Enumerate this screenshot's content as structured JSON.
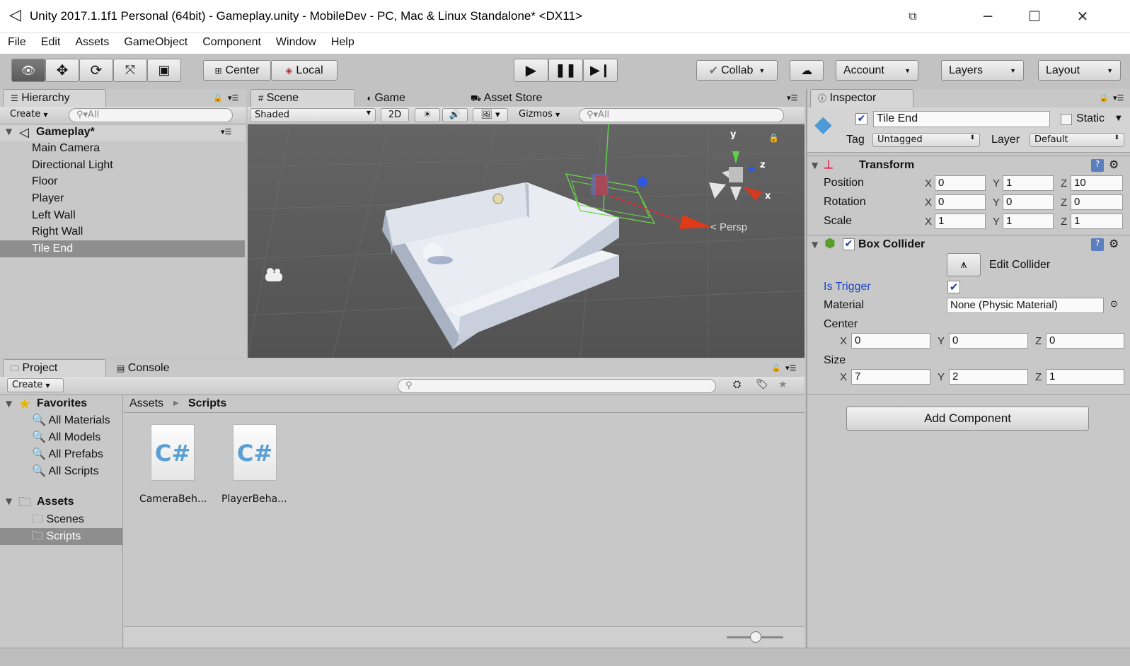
{
  "window": {
    "title": "Unity 2017.1.1f1 Personal (64bit) - Gameplay.unity - MobileDev - PC, Mac & Linux Standalone* <DX11>"
  },
  "menu": [
    "File",
    "Edit",
    "Assets",
    "GameObject",
    "Component",
    "Window",
    "Help"
  ],
  "toolbar": {
    "pivot": "Center",
    "space": "Local",
    "collab": "Collab",
    "account": "Account",
    "layers": "Layers",
    "layout": "Layout"
  },
  "hierarchy": {
    "tab": "Hierarchy",
    "create": "Create",
    "search_placeholder": "All",
    "scene": "Gameplay*",
    "items": [
      "Main Camera",
      "Directional Light",
      "Floor",
      "Player",
      "Left Wall",
      "Right Wall",
      "Tile End"
    ],
    "selected": "Tile End"
  },
  "scene_tabs": [
    "Scene",
    "Game",
    "Asset Store"
  ],
  "scene_bar": {
    "shading": "Shaded",
    "mode2d": "2D",
    "gizmos": "Gizmos",
    "search_placeholder": "All",
    "persp": "Persp",
    "axis_y": "y",
    "axis_z": "z",
    "axis_x": "x"
  },
  "project": {
    "tab": "Project",
    "console_tab": "Console",
    "create": "Create",
    "favorites_label": "Favorites",
    "favorites": [
      "All Materials",
      "All Models",
      "All Prefabs",
      "All Scripts"
    ],
    "assets_label": "Assets",
    "folders": [
      "Scenes",
      "Scripts"
    ],
    "selected_folder": "Scripts",
    "breadcrumb": [
      "Assets",
      "Scripts"
    ],
    "files": [
      "CameraBeh...",
      "PlayerBeha..."
    ],
    "file_icon_text": "C#"
  },
  "inspector": {
    "tab": "Inspector",
    "object_name": "Tile End",
    "static_label": "Static",
    "tag_label": "Tag",
    "tag_value": "Untagged",
    "layer_label": "Layer",
    "layer_value": "Default",
    "transform": {
      "title": "Transform",
      "position_label": "Position",
      "rotation_label": "Rotation",
      "scale_label": "Scale",
      "position": [
        "0",
        "1",
        "10"
      ],
      "rotation": [
        "0",
        "0",
        "0"
      ],
      "scale": [
        "1",
        "1",
        "1"
      ]
    },
    "box_collider": {
      "title": "Box Collider",
      "edit_collider": "Edit Collider",
      "is_trigger_label": "Is Trigger",
      "material_label": "Material",
      "material_value": "None (Physic Material)",
      "center_label": "Center",
      "center": [
        "0",
        "0",
        "0"
      ],
      "size_label": "Size",
      "size": [
        "7",
        "2",
        "1"
      ]
    },
    "add_component": "Add Component"
  },
  "axis_labels": [
    "X",
    "Y",
    "Z"
  ]
}
